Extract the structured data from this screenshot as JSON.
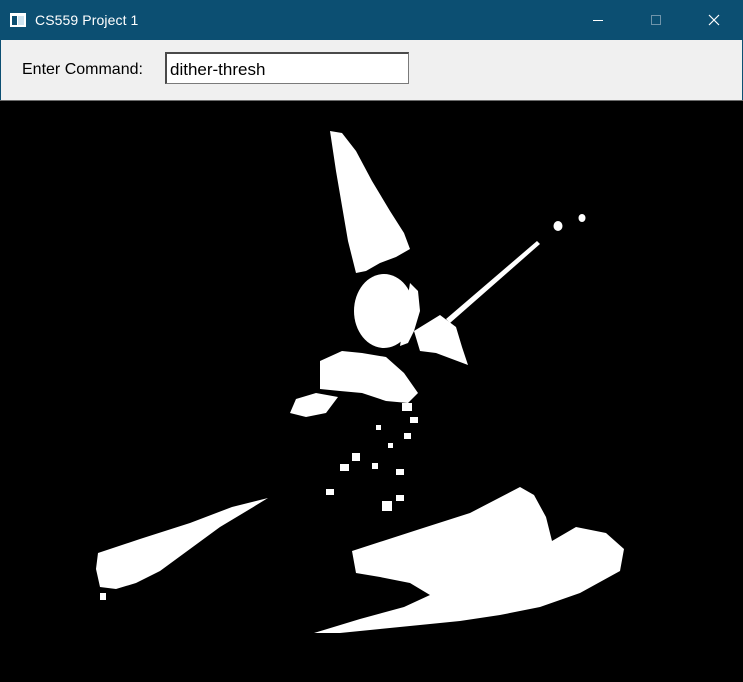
{
  "window": {
    "title": "CS559 Project 1",
    "icon": "app-window-icon",
    "controls": [
      "minimize-icon",
      "maximize-icon",
      "close-icon"
    ]
  },
  "toolbar": {
    "command_label": "Enter Command:",
    "command_value": "dither-thresh"
  },
  "canvas": {
    "background": "#000000",
    "foreground": "#ffffff",
    "content": "dithered-threshold-image"
  },
  "colors": {
    "titlebar": "#0c4f72",
    "toolbar": "#f0f0f0"
  }
}
